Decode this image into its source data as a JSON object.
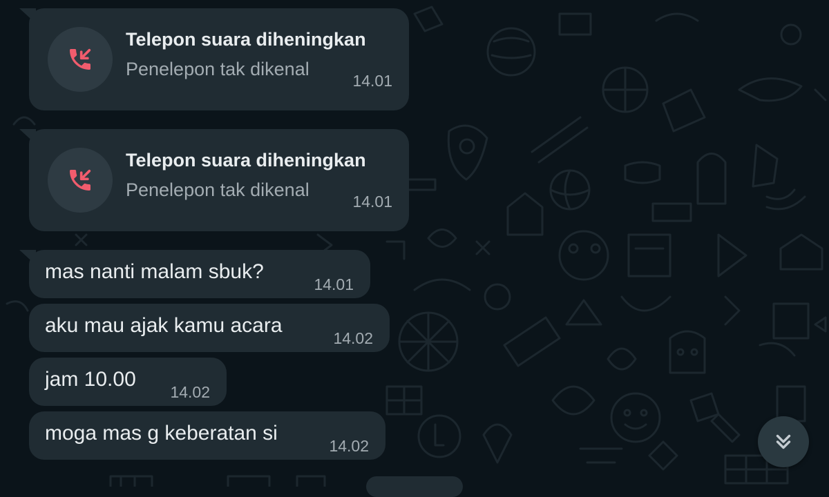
{
  "colors": {
    "background": "#0b141a",
    "bubble": "#202c33",
    "icon_circle": "#2e3b43",
    "missed_call_red": "#f15c6d",
    "text_primary": "#e9edef",
    "text_secondary": "#a3acb2",
    "doodle": "#1a252c"
  },
  "messages": [
    {
      "type": "call",
      "icon": "silenced-incoming-call-icon",
      "title": "Telepon suara diheningkan",
      "subtitle": "Penelepon tak dikenal",
      "time": "14.01"
    },
    {
      "type": "call",
      "icon": "silenced-incoming-call-icon",
      "title": "Telepon suara diheningkan",
      "subtitle": "Penelepon tak dikenal",
      "time": "14.01"
    },
    {
      "type": "text",
      "text": "mas nanti malam sbuk?",
      "time": "14.01"
    },
    {
      "type": "text",
      "text": "aku mau ajak kamu acara",
      "time": "14.02"
    },
    {
      "type": "text",
      "text": "jam 10.00",
      "time": "14.02"
    },
    {
      "type": "text",
      "text": "moga mas g keberatan si",
      "time": "14.02"
    }
  ],
  "scroll_button": {
    "icon": "double-chevron-down-icon"
  }
}
